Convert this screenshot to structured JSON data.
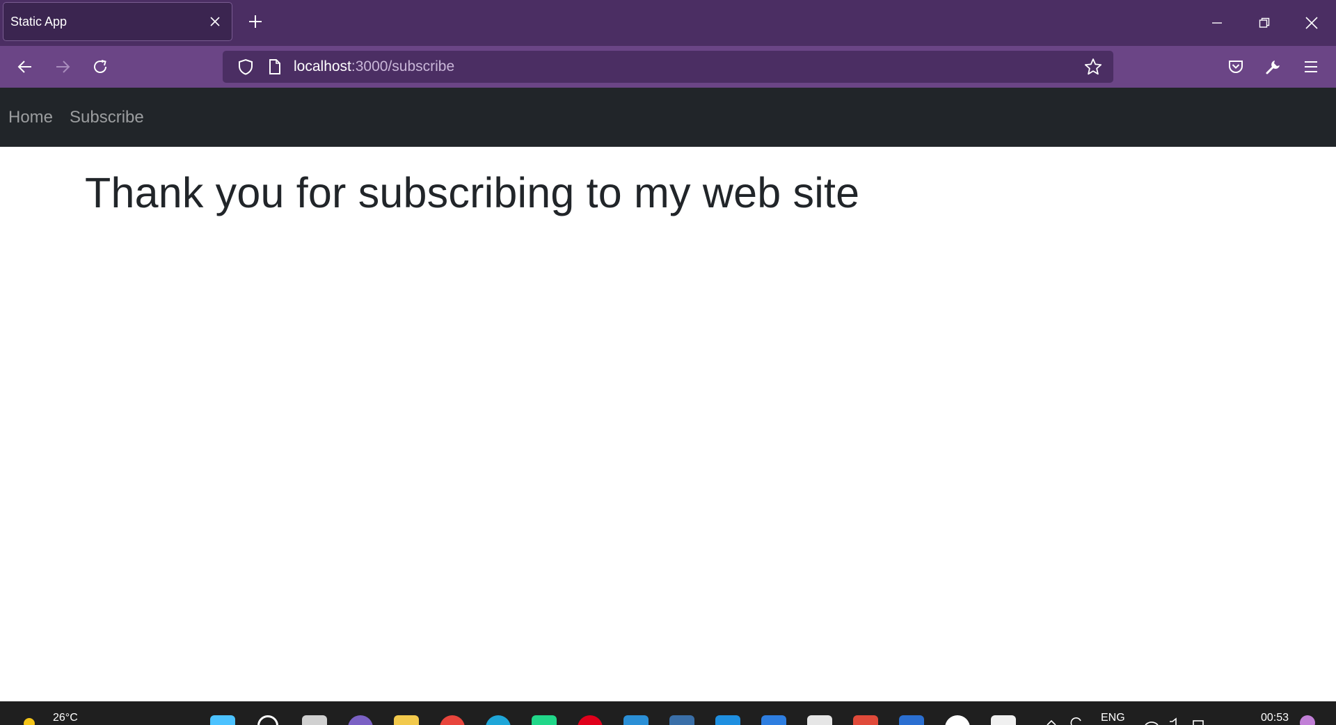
{
  "browser": {
    "tab_title": "Static App",
    "url_host": "localhost",
    "url_path": ":3000/subscribe"
  },
  "site": {
    "nav_links": [
      "Home",
      "Subscribe"
    ],
    "heading": "Thank you for subscribing to my web site"
  },
  "taskbar": {
    "temperature": "26°C",
    "language": "ENG",
    "time": "00:53"
  },
  "colors": {
    "tabstrip": "#4b2e63",
    "toolbar": "#6b4586",
    "site_nav": "#212529",
    "heading_text": "#212529"
  }
}
